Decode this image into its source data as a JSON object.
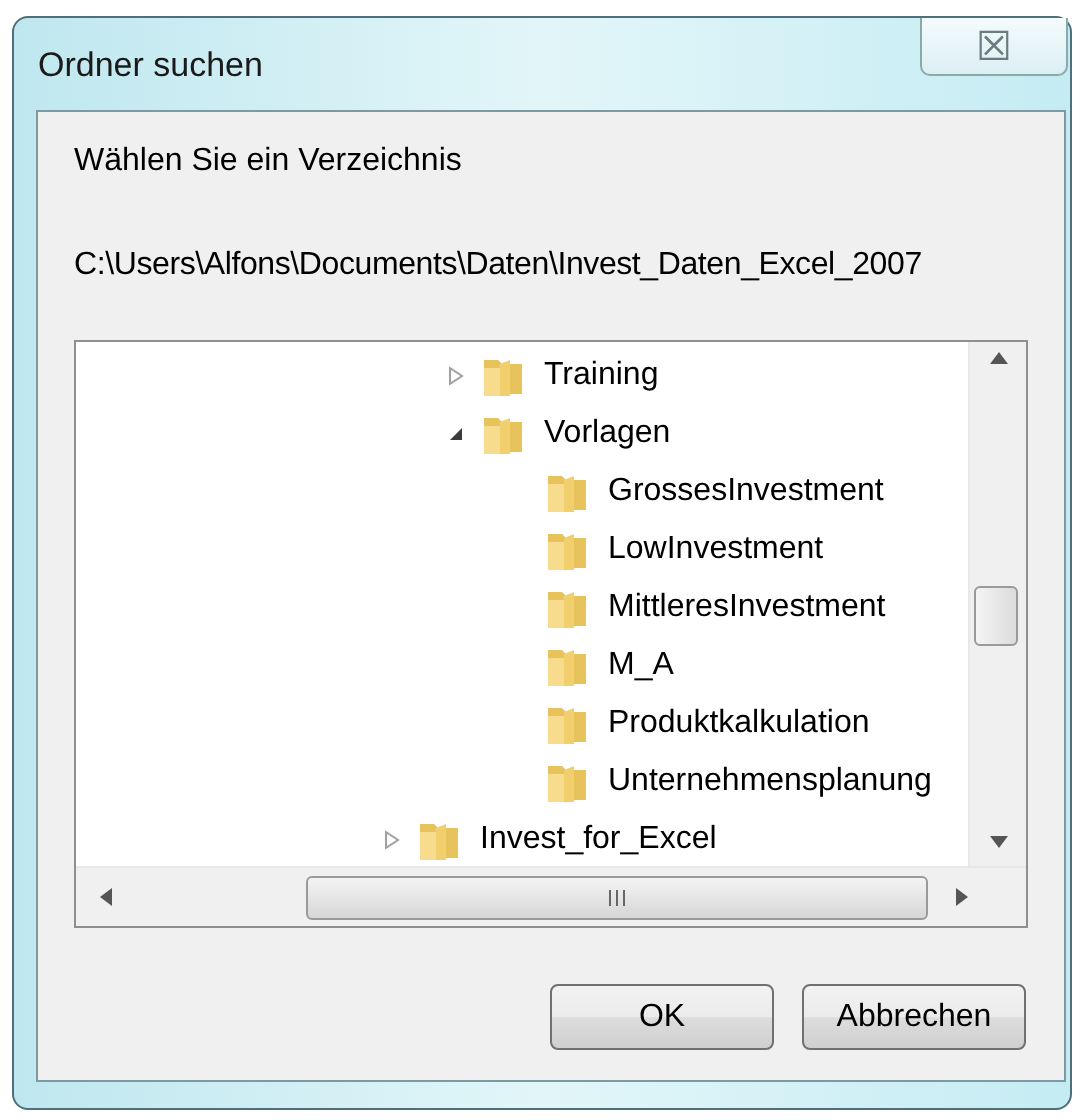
{
  "window": {
    "title": "Ordner suchen",
    "close": "☒"
  },
  "prompt": "Wählen Sie ein Verzeichnis",
  "path": "C:\\Users\\Alfons\\Documents\\Daten\\Invest_Daten_Excel_2007",
  "tree": {
    "items": [
      {
        "children": [
          {
            "label": "Training",
            "expanded": false
          },
          {
            "label": "Vorlagen",
            "expanded": true,
            "children": [
              {
                "label": "GrossesInvestment"
              },
              {
                "label": "LowInvestment"
              },
              {
                "label": "MittleresInvestment"
              },
              {
                "label": "M_A"
              },
              {
                "label": "Produktkalkulation"
              },
              {
                "label": "Unternehmensplanung"
              }
            ]
          }
        ]
      },
      {
        "label": "Invest_for_Excel",
        "expanded": false
      }
    ]
  },
  "buttons": [
    "OK",
    "Abbrechen"
  ]
}
